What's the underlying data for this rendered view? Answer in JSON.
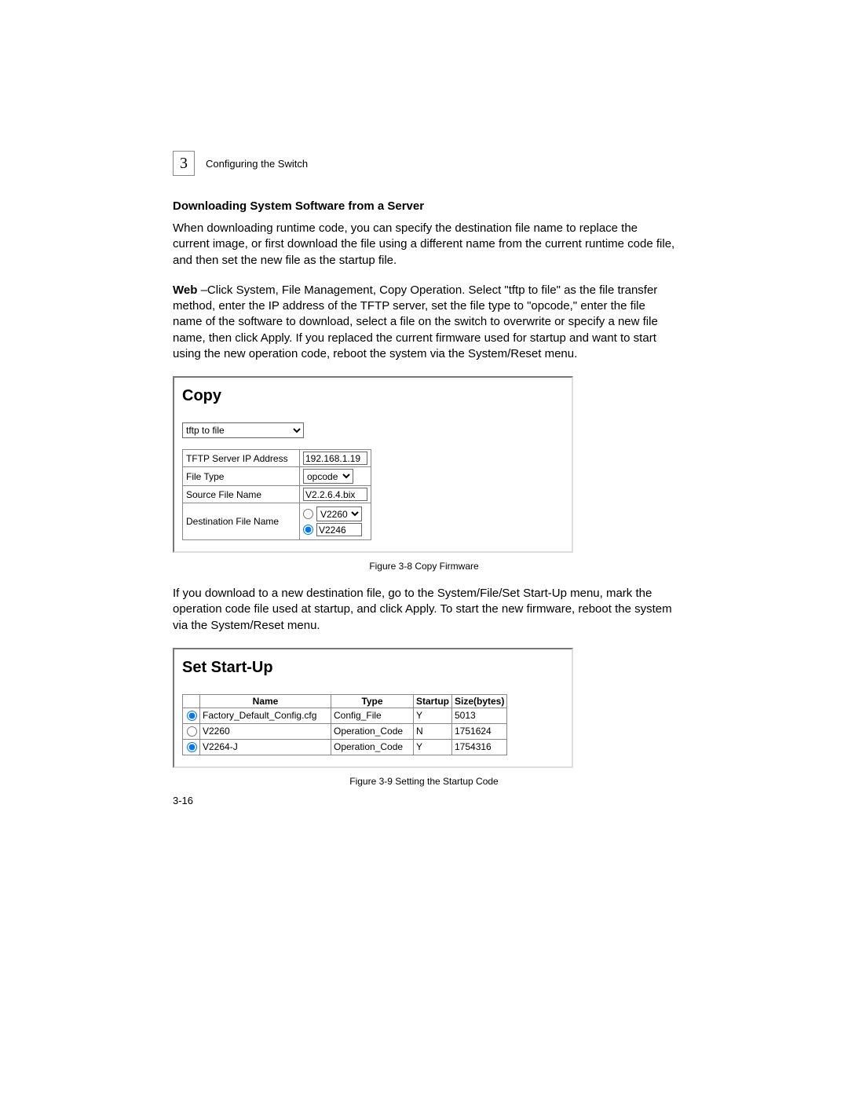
{
  "chapter": {
    "number": "3",
    "title": "Configuring the Switch"
  },
  "section_title": "Downloading System Software from a Server",
  "para1": "When downloading runtime code, you can specify the destination file name to replace the current image, or first download the file using a different name from the current runtime code file, and then set the new file as the startup file.",
  "para2_lead": "Web",
  "para2_rest": " –Click System, File Management, Copy Operation. Select \"tftp to file\" as the file transfer method, enter the IP address of the TFTP server, set the file type to \"opcode,\" enter the file name of the software to download, select a file on the switch to overwrite or specify a new file name, then click Apply. If you replaced the current firmware used for startup and want to start using the new operation code, reboot the system via the System/Reset menu.",
  "copy_panel": {
    "title": "Copy",
    "mode": "tftp to file",
    "rows": {
      "ip_label": "TFTP Server IP Address",
      "ip_value": "192.168.1.19",
      "filetype_label": "File Type",
      "filetype_value": "opcode",
      "source_label": "Source File Name",
      "source_value": "V2.2.6.4.bix",
      "dest_label": "Destination File Name",
      "dest_select": "V2260",
      "dest_text": "V2246"
    }
  },
  "fig1": "Figure 3-8  Copy Firmware",
  "para3": "If you download to a new destination file, go to the System/File/Set Start-Up menu, mark the operation code file used at startup, and click Apply. To start the new firmware, reboot the system via the System/Reset menu.",
  "startup_panel": {
    "title": "Set Start-Up",
    "headers": {
      "name": "Name",
      "type": "Type",
      "startup": "Startup",
      "size": "Size(bytes)"
    },
    "rows": [
      {
        "selected": true,
        "name": "Factory_Default_Config.cfg",
        "type": "Config_File",
        "startup": "Y",
        "size": "5013"
      },
      {
        "selected": false,
        "name": "V2260",
        "type": "Operation_Code",
        "startup": "N",
        "size": "1751624"
      },
      {
        "selected": true,
        "name": "V2264-J",
        "type": "Operation_Code",
        "startup": "Y",
        "size": "1754316"
      }
    ]
  },
  "fig2": "Figure 3-9  Setting the Startup Code",
  "page_number": "3-16"
}
